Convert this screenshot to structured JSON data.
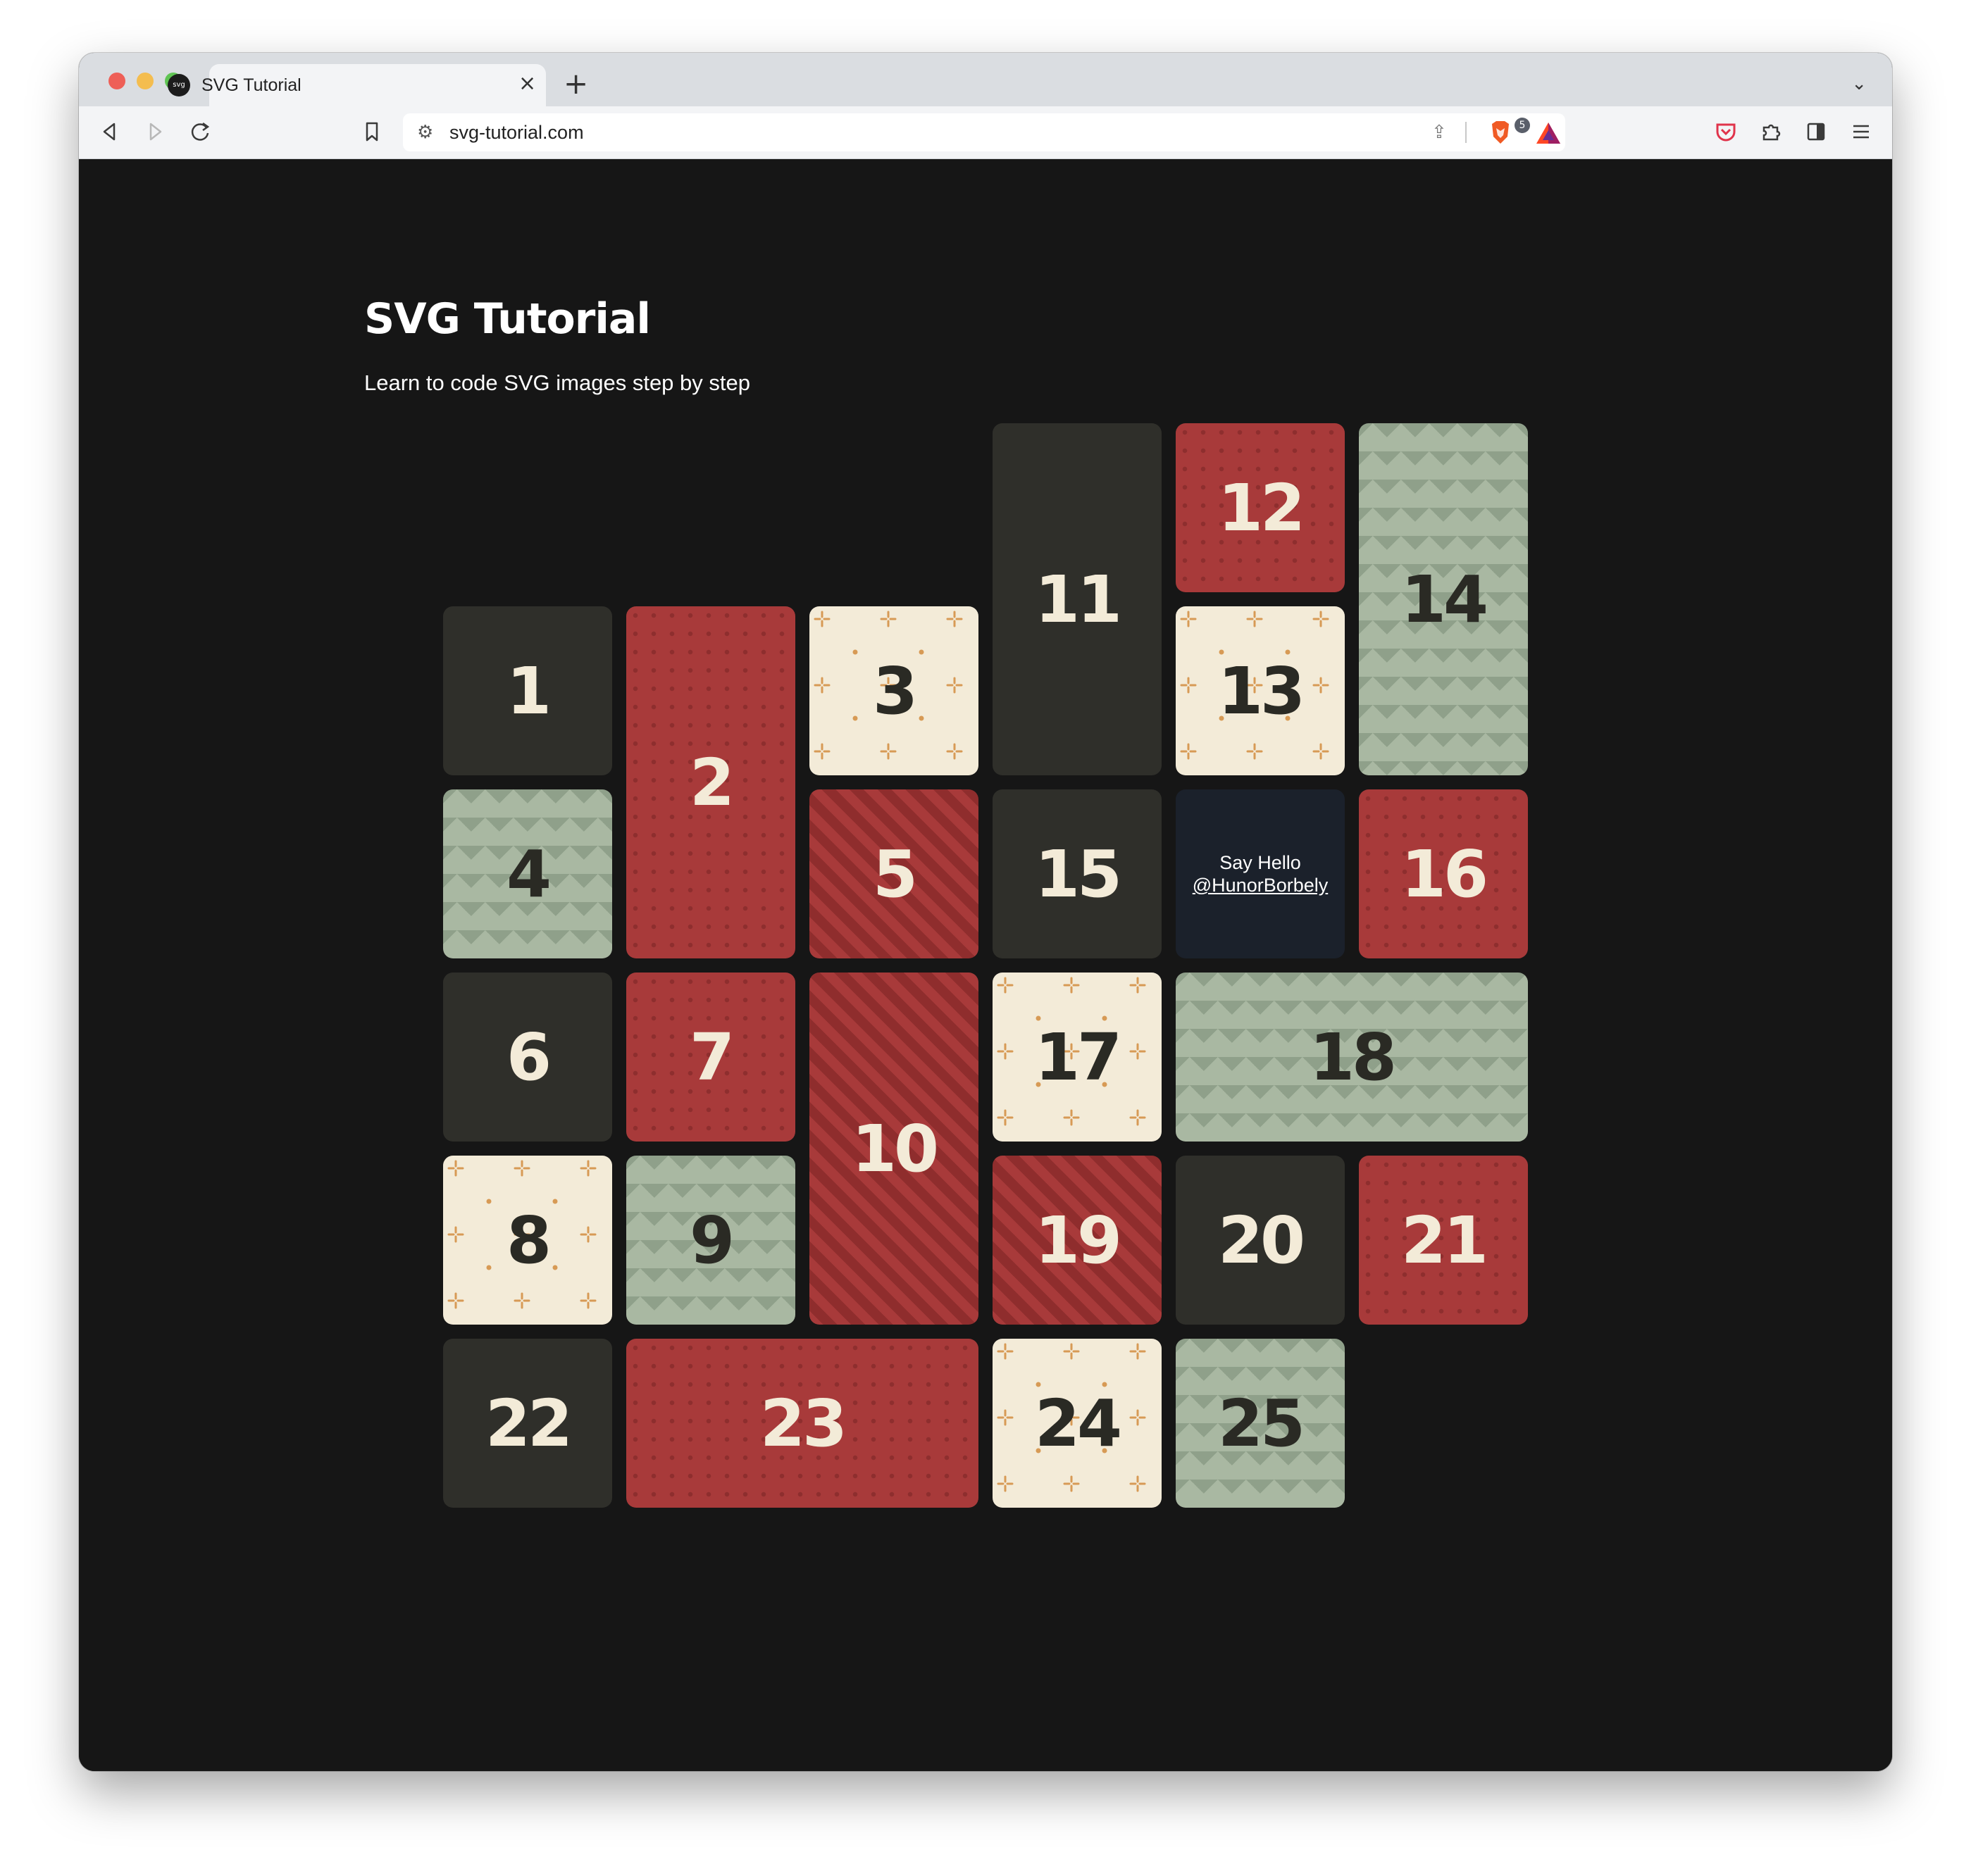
{
  "browser": {
    "tab_title": "SVG Tutorial",
    "tab_favicon_text": "svg",
    "url": "svg-tutorial.com",
    "brave_badge": "5"
  },
  "page": {
    "title": "SVG Tutorial",
    "subtitle": "Learn to code SVG images step by step",
    "hello_line1": "Say Hello",
    "hello_handle": "@HunorBorbely",
    "tiles": [
      "1",
      "2",
      "3",
      "4",
      "5",
      "6",
      "7",
      "8",
      "9",
      "10",
      "11",
      "12",
      "13",
      "14",
      "15",
      "16",
      "17",
      "18",
      "19",
      "20",
      "21",
      "22",
      "23",
      "24",
      "25"
    ]
  },
  "colors": {
    "dark": "#2f2f2a",
    "red": "#a83a3a",
    "cream": "#f3ebd8",
    "sage": "#a9b8a2",
    "navy": "#1b212b",
    "background": "#161616"
  },
  "icons": [
    "back-icon",
    "forward-icon",
    "reload-icon",
    "bookmark-icon",
    "site-info-icon",
    "share-icon",
    "brave-shield-icon",
    "bat-rewards-icon",
    "pocket-icon",
    "extensions-icon",
    "sidebar-icon",
    "menu-icon",
    "close-icon",
    "plus-icon",
    "chevron-down-icon"
  ]
}
